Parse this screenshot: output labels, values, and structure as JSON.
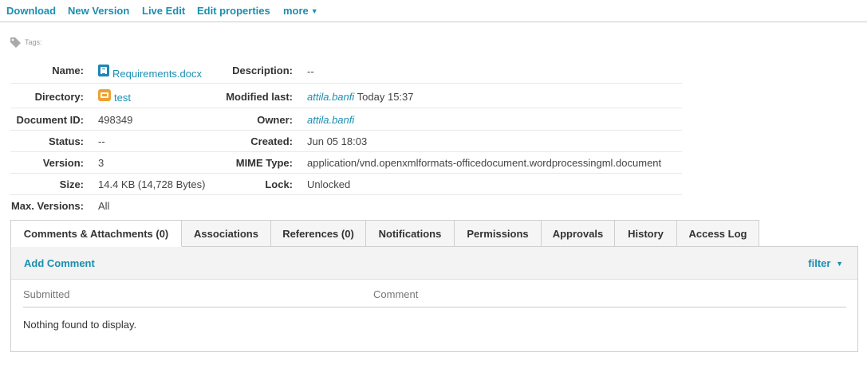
{
  "toolbar": {
    "download": "Download",
    "new_version": "New Version",
    "live_edit": "Live Edit",
    "edit_properties": "Edit properties",
    "more": "more"
  },
  "tags": {
    "label": "Tags:"
  },
  "properties": {
    "name_label": "Name:",
    "name_value": "Requirements.docx",
    "description_label": "Description:",
    "description_value": "--",
    "directory_label": "Directory:",
    "directory_value": "test",
    "modified_label": "Modified last:",
    "modified_user": "attila.banfi",
    "modified_time": "Today 15:37",
    "docid_label": "Document ID:",
    "docid_value": "498349",
    "owner_label": "Owner:",
    "owner_value": "attila.banfi",
    "status_label": "Status:",
    "status_value": "--",
    "created_label": "Created:",
    "created_value": "Jun 05 18:03",
    "version_label": "Version:",
    "version_value": "3",
    "mime_label": "MIME Type:",
    "mime_value": "application/vnd.openxmlformats-officedocument.wordprocessingml.document",
    "size_label": "Size:",
    "size_value": "14.4 KB (14,728 Bytes)",
    "lock_label": "Lock:",
    "lock_value": "Unlocked",
    "maxver_label": "Max. Versions:",
    "maxver_value": "All"
  },
  "tabs": [
    {
      "label": "Comments & Attachments (0)",
      "active": true
    },
    {
      "label": "Associations",
      "active": false
    },
    {
      "label": "References (0)",
      "active": false
    },
    {
      "label": "Notifications",
      "active": false
    },
    {
      "label": "Permissions",
      "active": false
    },
    {
      "label": "Approvals",
      "active": false
    },
    {
      "label": "History",
      "active": false
    },
    {
      "label": "Access Log",
      "active": false
    }
  ],
  "panel": {
    "add_comment": "Add Comment",
    "filter": "filter",
    "col_submitted": "Submitted",
    "col_comment": "Comment",
    "empty_message": "Nothing found to display."
  },
  "colors": {
    "link": "#1a8fb0",
    "file_icon": "#1d86b1",
    "folder_icon": "#f0a030"
  },
  "icons": {
    "tag": "tag-icon",
    "file": "docx-file-icon",
    "folder": "folder-icon",
    "more_caret": "caret-down-icon",
    "filter_caret": "caret-down-icon"
  }
}
